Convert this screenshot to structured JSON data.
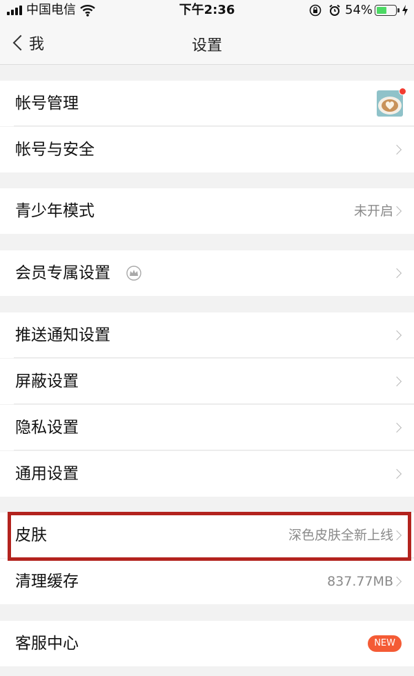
{
  "status_bar": {
    "carrier": "中国电信",
    "time": "下午2:36",
    "battery": "54%",
    "battery_level": 0.54,
    "icons": [
      "signal-icon",
      "wifi-icon",
      "lock-rotation-icon",
      "alarm-icon",
      "battery-icon",
      "charging-icon"
    ]
  },
  "nav": {
    "back_label": "我",
    "title": "设置"
  },
  "groups": {
    "account": {
      "manage": {
        "label": "帐号管理",
        "has_notification_dot": true
      },
      "security": {
        "label": "帐号与安全"
      }
    },
    "youth": {
      "label": "青少年模式",
      "value": "未开启"
    },
    "member": {
      "label": "会员专属设置",
      "icon": "crown-icon"
    },
    "settings": {
      "push": {
        "label": "推送通知设置"
      },
      "block": {
        "label": "屏蔽设置"
      },
      "privacy": {
        "label": "隐私设置"
      },
      "general": {
        "label": "通用设置"
      }
    },
    "skin": {
      "label": "皮肤",
      "value": "深色皮肤全新上线",
      "highlighted": true
    },
    "cache": {
      "label": "清理缓存",
      "value": "837.77MB"
    },
    "service": {
      "label": "客服中心",
      "badge": "NEW"
    }
  },
  "colors": {
    "highlight_border": "#b3231e",
    "badge_bg": "#f45b35",
    "notification_dot": "#f23c31",
    "battery_fill": "#4cd964"
  }
}
